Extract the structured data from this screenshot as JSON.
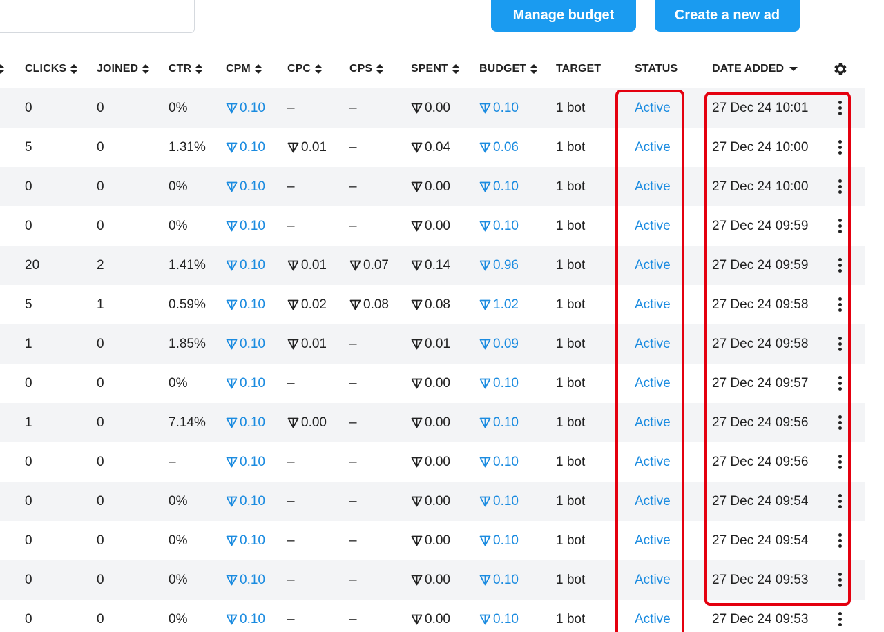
{
  "toolbar": {
    "manage_budget_label": "Manage budget",
    "create_ad_label": "Create a new ad"
  },
  "columns": {
    "clicks": "CLICKS",
    "joined": "JOINED",
    "ctr": "CTR",
    "cpm": "CPM",
    "cpc": "CPC",
    "cps": "CPS",
    "spent": "SPENT",
    "budget": "BUDGET",
    "target": "TARGET",
    "status": "STATUS",
    "date_added": "DATE ADDED"
  },
  "icons": {
    "currency": "ton-icon",
    "settings": "gear-icon",
    "row_menu": "kebab-menu-icon"
  },
  "colors": {
    "accent": "#1a9bf0",
    "link": "#1a8be0",
    "highlight": "#e4000f",
    "row_stripe": "#f3f4f6"
  },
  "rows": [
    {
      "clicks": "0",
      "joined": "0",
      "ctr": "0%",
      "cpm": "0.10",
      "cpc": "–",
      "cps": "–",
      "spent": "0.00",
      "budget": "0.10",
      "target": "1 bot",
      "status": "Active",
      "date": "27 Dec 24 10:01"
    },
    {
      "clicks": "5",
      "joined": "0",
      "ctr": "1.31%",
      "cpm": "0.10",
      "cpc": "0.01",
      "cps": "–",
      "spent": "0.04",
      "budget": "0.06",
      "target": "1 bot",
      "status": "Active",
      "date": "27 Dec 24 10:00"
    },
    {
      "clicks": "0",
      "joined": "0",
      "ctr": "0%",
      "cpm": "0.10",
      "cpc": "–",
      "cps": "–",
      "spent": "0.00",
      "budget": "0.10",
      "target": "1 bot",
      "status": "Active",
      "date": "27 Dec 24 10:00"
    },
    {
      "clicks": "0",
      "joined": "0",
      "ctr": "0%",
      "cpm": "0.10",
      "cpc": "–",
      "cps": "–",
      "spent": "0.00",
      "budget": "0.10",
      "target": "1 bot",
      "status": "Active",
      "date": "27 Dec 24 09:59"
    },
    {
      "clicks": "20",
      "joined": "2",
      "ctr": "1.41%",
      "cpm": "0.10",
      "cpc": "0.01",
      "cps": "0.07",
      "spent": "0.14",
      "budget": "0.96",
      "target": "1 bot",
      "status": "Active",
      "date": "27 Dec 24 09:59"
    },
    {
      "clicks": "5",
      "joined": "1",
      "ctr": "0.59%",
      "cpm": "0.10",
      "cpc": "0.02",
      "cps": "0.08",
      "spent": "0.08",
      "budget": "1.02",
      "target": "1 bot",
      "status": "Active",
      "date": "27 Dec 24 09:58"
    },
    {
      "clicks": "1",
      "joined": "0",
      "ctr": "1.85%",
      "cpm": "0.10",
      "cpc": "0.01",
      "cps": "–",
      "spent": "0.01",
      "budget": "0.09",
      "target": "1 bot",
      "status": "Active",
      "date": "27 Dec 24 09:58"
    },
    {
      "clicks": "0",
      "joined": "0",
      "ctr": "0%",
      "cpm": "0.10",
      "cpc": "–",
      "cps": "–",
      "spent": "0.00",
      "budget": "0.10",
      "target": "1 bot",
      "status": "Active",
      "date": "27 Dec 24 09:57"
    },
    {
      "clicks": "1",
      "joined": "0",
      "ctr": "7.14%",
      "cpm": "0.10",
      "cpc": "0.00",
      "cps": "–",
      "spent": "0.00",
      "budget": "0.10",
      "target": "1 bot",
      "status": "Active",
      "date": "27 Dec 24 09:56"
    },
    {
      "clicks": "0",
      "joined": "0",
      "ctr": "–",
      "cpm": "0.10",
      "cpc": "–",
      "cps": "–",
      "spent": "0.00",
      "budget": "0.10",
      "target": "1 bot",
      "status": "Active",
      "date": "27 Dec 24 09:56"
    },
    {
      "clicks": "0",
      "joined": "0",
      "ctr": "0%",
      "cpm": "0.10",
      "cpc": "–",
      "cps": "–",
      "spent": "0.00",
      "budget": "0.10",
      "target": "1 bot",
      "status": "Active",
      "date": "27 Dec 24 09:54"
    },
    {
      "clicks": "0",
      "joined": "0",
      "ctr": "0%",
      "cpm": "0.10",
      "cpc": "–",
      "cps": "–",
      "spent": "0.00",
      "budget": "0.10",
      "target": "1 bot",
      "status": "Active",
      "date": "27 Dec 24 09:54"
    },
    {
      "clicks": "0",
      "joined": "0",
      "ctr": "0%",
      "cpm": "0.10",
      "cpc": "–",
      "cps": "–",
      "spent": "0.00",
      "budget": "0.10",
      "target": "1 bot",
      "status": "Active",
      "date": "27 Dec 24 09:53"
    },
    {
      "clicks": "0",
      "joined": "0",
      "ctr": "0%",
      "cpm": "0.10",
      "cpc": "–",
      "cps": "–",
      "spent": "0.00",
      "budget": "0.10",
      "target": "1 bot",
      "status": "Active",
      "date": "27 Dec 24 09:53"
    }
  ]
}
